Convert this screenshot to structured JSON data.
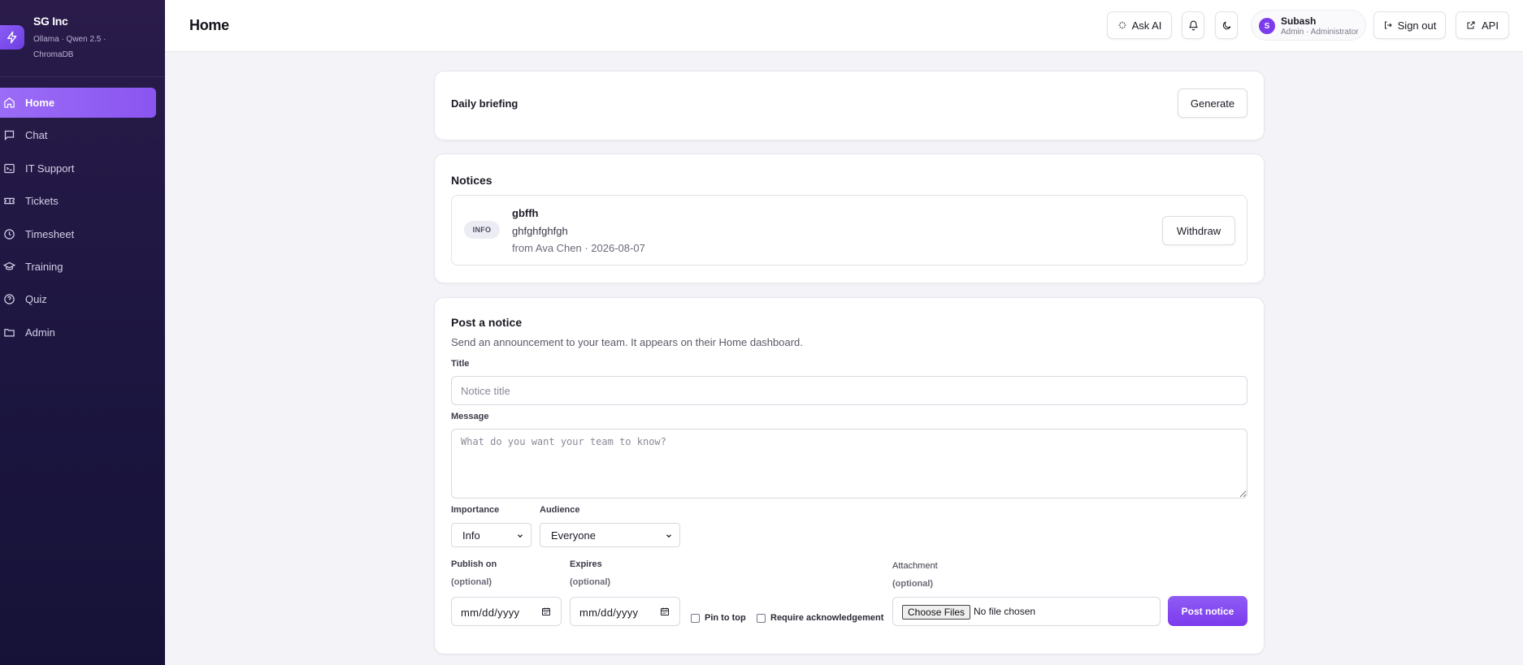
{
  "brand": {
    "name": "SG Inc",
    "subtitle": "Ollama · Qwen 2.5 · ChromaDB"
  },
  "sidebar": {
    "items": [
      {
        "label": "Home",
        "icon": "home-icon",
        "active": true
      },
      {
        "label": "Chat",
        "icon": "chat-icon"
      },
      {
        "label": "IT Support",
        "icon": "terminal-icon"
      },
      {
        "label": "Tickets",
        "icon": "ticket-icon"
      },
      {
        "label": "Timesheet",
        "icon": "clock-icon"
      },
      {
        "label": "Training",
        "icon": "graduation-cap-icon"
      },
      {
        "label": "Quiz",
        "icon": "help-circle-icon"
      },
      {
        "label": "Admin",
        "icon": "folder-icon"
      }
    ]
  },
  "header": {
    "title": "Home",
    "ask_ai_label": "Ask AI",
    "user": {
      "initial": "S",
      "name": "Subash",
      "role": "Admin · Administrator"
    },
    "sign_out_label": "Sign out",
    "api_label": "API"
  },
  "briefing": {
    "title": "Daily briefing",
    "generate_label": "Generate"
  },
  "notices": {
    "title": "Notices",
    "items": [
      {
        "badge": "INFO",
        "title": "gbffh",
        "body": "ghfghfghfgh",
        "meta": "from Ava Chen · 2026-08-07",
        "action": "Withdraw"
      }
    ]
  },
  "post": {
    "title": "Post a notice",
    "description": "Send an announcement to your team. It appears on their Home dashboard.",
    "title_label": "Title",
    "title_placeholder": "Notice title",
    "message_label": "Message",
    "message_placeholder": "What do you want your team to know?",
    "importance_label": "Importance",
    "importance_value": "Info",
    "audience_label": "Audience",
    "audience_value": "Everyone",
    "publish_label": "Publish on",
    "publish_sub": "(optional)",
    "publish_placeholder": "mm/dd/yyyy",
    "expires_label": "Expires",
    "expires_sub": "(optional)",
    "expires_placeholder": "mm/dd/yyyy",
    "pin_label": "Pin to top",
    "ack_label": "Require acknowledgement",
    "attachment_label": "Attachment",
    "attachment_sub": "(optional)",
    "choose_files_label": "Choose Files",
    "no_file_label": "No file chosen",
    "submit_label": "Post notice"
  },
  "colors": {
    "accent": "#8b5cf6",
    "sidebar_bg": "#1c1640"
  }
}
